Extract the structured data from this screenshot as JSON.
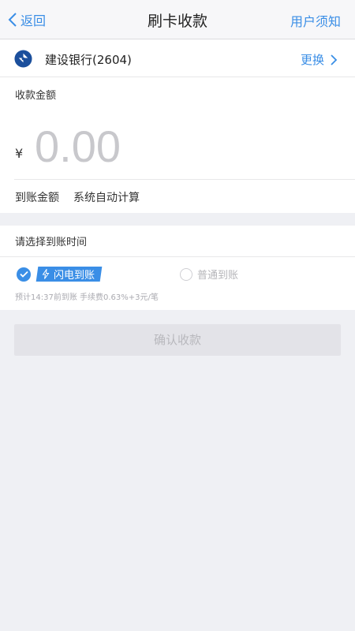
{
  "nav": {
    "back_label": "返回",
    "title": "刷卡收款",
    "notice_label": "用户须知"
  },
  "bank": {
    "name": "建设银行(2604)",
    "change_label": "更换",
    "logo_color": "#1b4f9c"
  },
  "amount": {
    "label": "收款金额",
    "currency_symbol": "¥",
    "placeholder": "0.00",
    "arrival_label": "到账金额",
    "arrival_value": "系统自动计算"
  },
  "settle_time": {
    "title": "请选择到账时间",
    "options": [
      {
        "label": "闪电到账",
        "selected": true
      },
      {
        "label": "普通到账",
        "selected": false
      }
    ],
    "fee_note": "预计14:37前到账  手续费0.63%+3元/笔"
  },
  "confirm": {
    "label": "确认收款",
    "enabled": false
  },
  "colors": {
    "accent": "#3a8ee6",
    "background": "#eff0f4"
  }
}
